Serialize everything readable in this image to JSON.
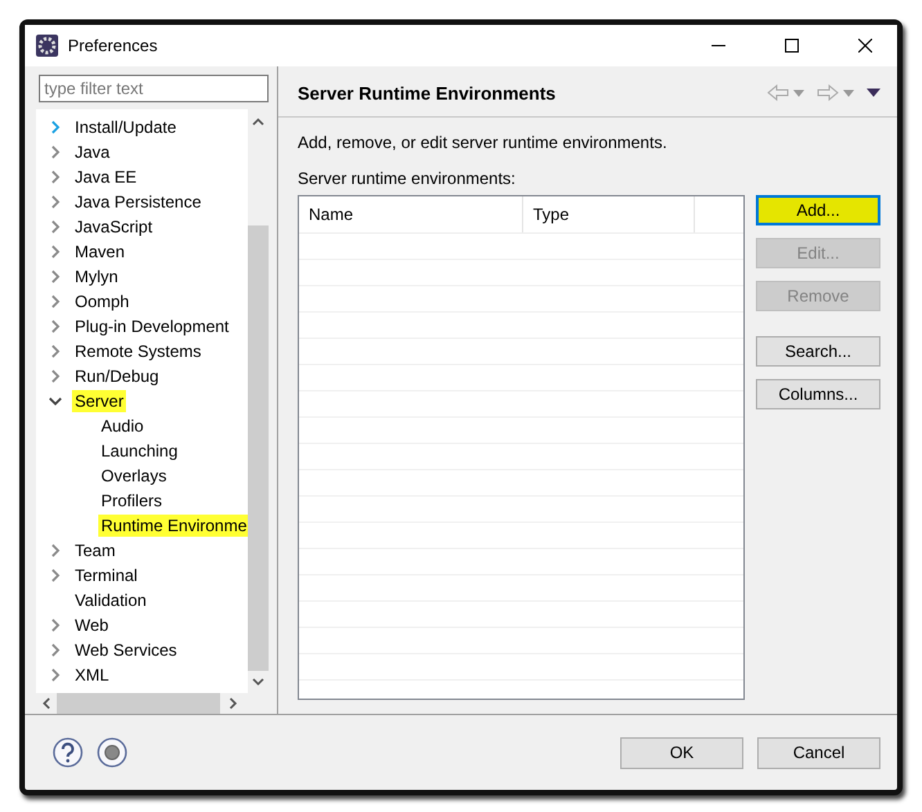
{
  "window": {
    "title": "Preferences"
  },
  "filter": {
    "placeholder": "type filter text"
  },
  "tree": [
    {
      "label": "Install/Update",
      "expandable": true,
      "expanded": false,
      "hot": true,
      "highlighted": false
    },
    {
      "label": "Java",
      "expandable": true,
      "expanded": false,
      "hot": false,
      "highlighted": false
    },
    {
      "label": "Java EE",
      "expandable": true,
      "expanded": false,
      "hot": false,
      "highlighted": false
    },
    {
      "label": "Java Persistence",
      "expandable": true,
      "expanded": false,
      "hot": false,
      "highlighted": false
    },
    {
      "label": "JavaScript",
      "expandable": true,
      "expanded": false,
      "hot": false,
      "highlighted": false
    },
    {
      "label": "Maven",
      "expandable": true,
      "expanded": false,
      "hot": false,
      "highlighted": false
    },
    {
      "label": "Mylyn",
      "expandable": true,
      "expanded": false,
      "hot": false,
      "highlighted": false
    },
    {
      "label": "Oomph",
      "expandable": true,
      "expanded": false,
      "hot": false,
      "highlighted": false
    },
    {
      "label": "Plug-in Development",
      "expandable": true,
      "expanded": false,
      "hot": false,
      "highlighted": false
    },
    {
      "label": "Remote Systems",
      "expandable": true,
      "expanded": false,
      "hot": false,
      "highlighted": false
    },
    {
      "label": "Run/Debug",
      "expandable": true,
      "expanded": false,
      "hot": false,
      "highlighted": false
    },
    {
      "label": "Server",
      "expandable": true,
      "expanded": true,
      "hot": false,
      "highlighted": true,
      "children": [
        {
          "label": "Audio",
          "expandable": false,
          "highlighted": false
        },
        {
          "label": "Launching",
          "expandable": false,
          "highlighted": false
        },
        {
          "label": "Overlays",
          "expandable": false,
          "highlighted": false
        },
        {
          "label": "Profilers",
          "expandable": false,
          "highlighted": false
        },
        {
          "label": "Runtime Environme",
          "expandable": false,
          "highlighted": true
        }
      ]
    },
    {
      "label": "Team",
      "expandable": true,
      "expanded": false,
      "hot": false,
      "highlighted": false
    },
    {
      "label": "Terminal",
      "expandable": true,
      "expanded": false,
      "hot": false,
      "highlighted": false
    },
    {
      "label": "Validation",
      "expandable": false,
      "highlighted": false
    },
    {
      "label": "Web",
      "expandable": true,
      "expanded": false,
      "hot": false,
      "highlighted": false
    },
    {
      "label": "Web Services",
      "expandable": true,
      "expanded": false,
      "hot": false,
      "highlighted": false
    },
    {
      "label": "XML",
      "expandable": true,
      "expanded": false,
      "hot": false,
      "highlighted": false
    }
  ],
  "page": {
    "title": "Server Runtime Environments",
    "description": "Add, remove, or edit server runtime environments.",
    "table_label": "Server runtime environments:"
  },
  "table": {
    "columns": [
      "Name",
      "Type"
    ]
  },
  "side_buttons": [
    {
      "label": "Add...",
      "disabled": false,
      "focused": true,
      "highlighted": true
    },
    {
      "label": "Edit...",
      "disabled": true,
      "focused": false,
      "highlighted": false
    },
    {
      "label": "Remove",
      "disabled": true,
      "focused": false,
      "highlighted": false
    },
    {
      "label": "Search...",
      "disabled": false,
      "focused": false,
      "highlighted": false
    },
    {
      "label": "Columns...",
      "disabled": false,
      "focused": false,
      "highlighted": false
    }
  ],
  "buttons": [
    "OK",
    "Cancel"
  ]
}
